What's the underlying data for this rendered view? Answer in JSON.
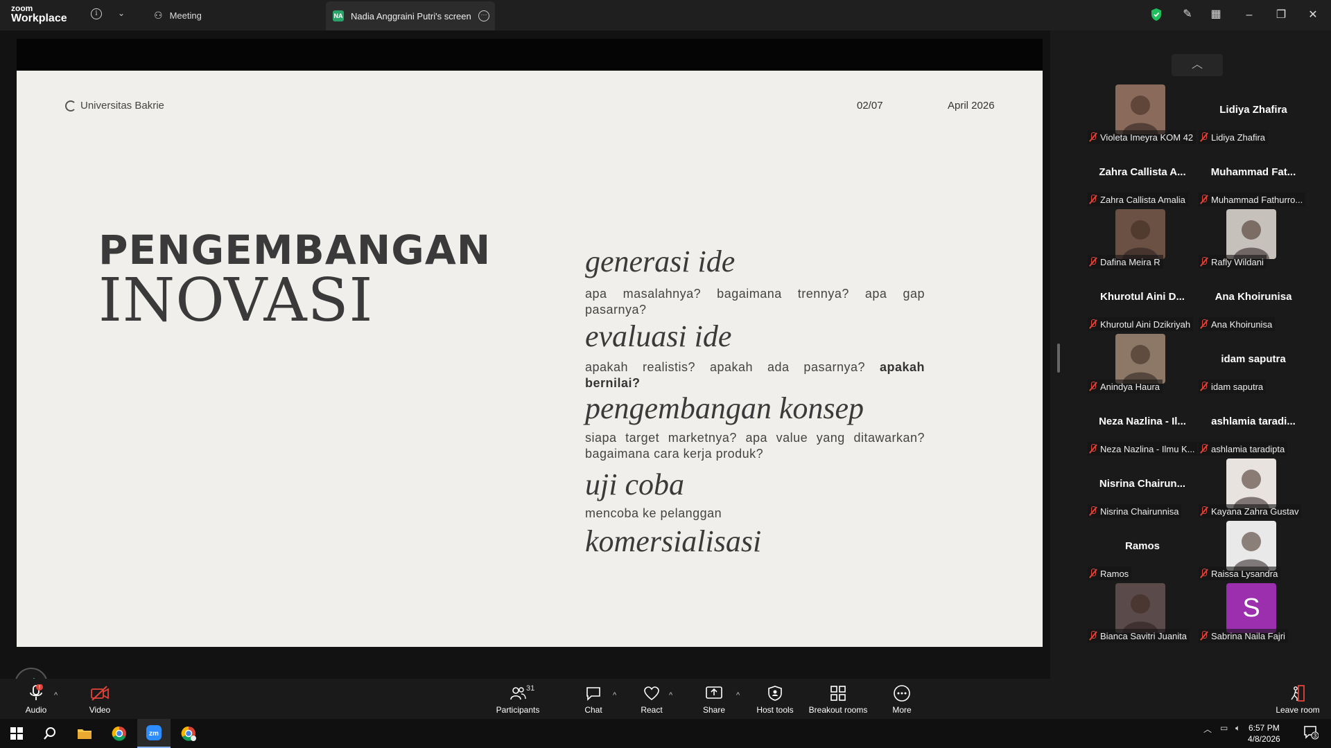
{
  "app": {
    "logo_top": "zoom",
    "logo_bottom": "Workplace",
    "meeting_tab": "Meeting",
    "share_tab": "Nadia Anggraini Putri's screen",
    "share_tab_initials": "NA"
  },
  "slide": {
    "logo_text": "Universitas Bakrie",
    "page": "02/07",
    "date": "April 2026",
    "title_line1": "PENGEMBANGAN",
    "title_line2": "INOVASI",
    "steps": [
      {
        "head": "generasi ide",
        "desc": "apa masalahnya? bagaimana trennya? apa gap pasarnya?"
      },
      {
        "head": "evaluasi ide",
        "desc": "apakah realistis? apakah ada pasarnya?",
        "desc_bold": "apakah bernilai?"
      },
      {
        "head": "pengembangan konsep",
        "desc": "siapa target marketnya? apa value yang ditawarkan? bagaimana cara kerja produk?"
      },
      {
        "head": "uji coba",
        "desc": "mencoba ke pelanggan"
      },
      {
        "head": "komersialisasi"
      }
    ]
  },
  "participants": [
    {
      "label": "Violeta Imeyra KOM 42",
      "video": true,
      "color": "#8a6a5a"
    },
    {
      "label": "Lidiya Zhafira",
      "bigname": "Lidiya Zhafira"
    },
    {
      "label": "Zahra Callista Amalia",
      "bigname": "Zahra Callista A..."
    },
    {
      "label": "Muhammad Fathurro...",
      "bigname": "Muhammad Fat..."
    },
    {
      "label": "Dafina Meira R",
      "video": true,
      "color": "#6b5044"
    },
    {
      "label": "Rafly Wildani",
      "video": true,
      "color": "#c7c1bb"
    },
    {
      "label": "Khurotul Aini Dzikriyah",
      "bigname": "Khurotul Aini D..."
    },
    {
      "label": "Ana Khoirunisa",
      "bigname": "Ana Khoirunisa"
    },
    {
      "label": "Anindya Haura",
      "video": true,
      "color": "#8d7867"
    },
    {
      "label": "idam saputra",
      "bigname": "idam saputra"
    },
    {
      "label": "Neza Nazlina - Ilmu K...",
      "bigname": "Neza Nazlina - Il..."
    },
    {
      "label": "ashlamia taradipta",
      "bigname": "ashlamia taradi..."
    },
    {
      "label": "Nisrina Chairunnisa",
      "bigname": "Nisrina Chairun..."
    },
    {
      "label": "Kayana Zahra Gustav",
      "video": true,
      "color": "#e8e3df"
    },
    {
      "label": "Ramos",
      "bigname": "Ramos"
    },
    {
      "label": "Raissa Lysandra",
      "video": true,
      "color": "#e9e9e9"
    },
    {
      "label": "Bianca Savitri Juanita",
      "video": true,
      "color": "#5b4a4a"
    },
    {
      "label": "Sabrina Naila Fajri",
      "initial": "S",
      "color": "#9b2fae"
    }
  ],
  "toolbar": {
    "audio": "Audio",
    "video": "Video",
    "participants": "Participants",
    "participants_count": "31",
    "chat": "Chat",
    "react": "React",
    "share": "Share",
    "host_tools": "Host tools",
    "breakout": "Breakout rooms",
    "more": "More",
    "leave": "Leave room"
  },
  "taskbar": {
    "time": "6:57 PM",
    "date": "4/8/2026",
    "notif_count": "3"
  },
  "colors": {
    "accent_green": "#1fbf5c",
    "mute_red": "#e2443a",
    "slide_bg": "#f1efeb"
  }
}
